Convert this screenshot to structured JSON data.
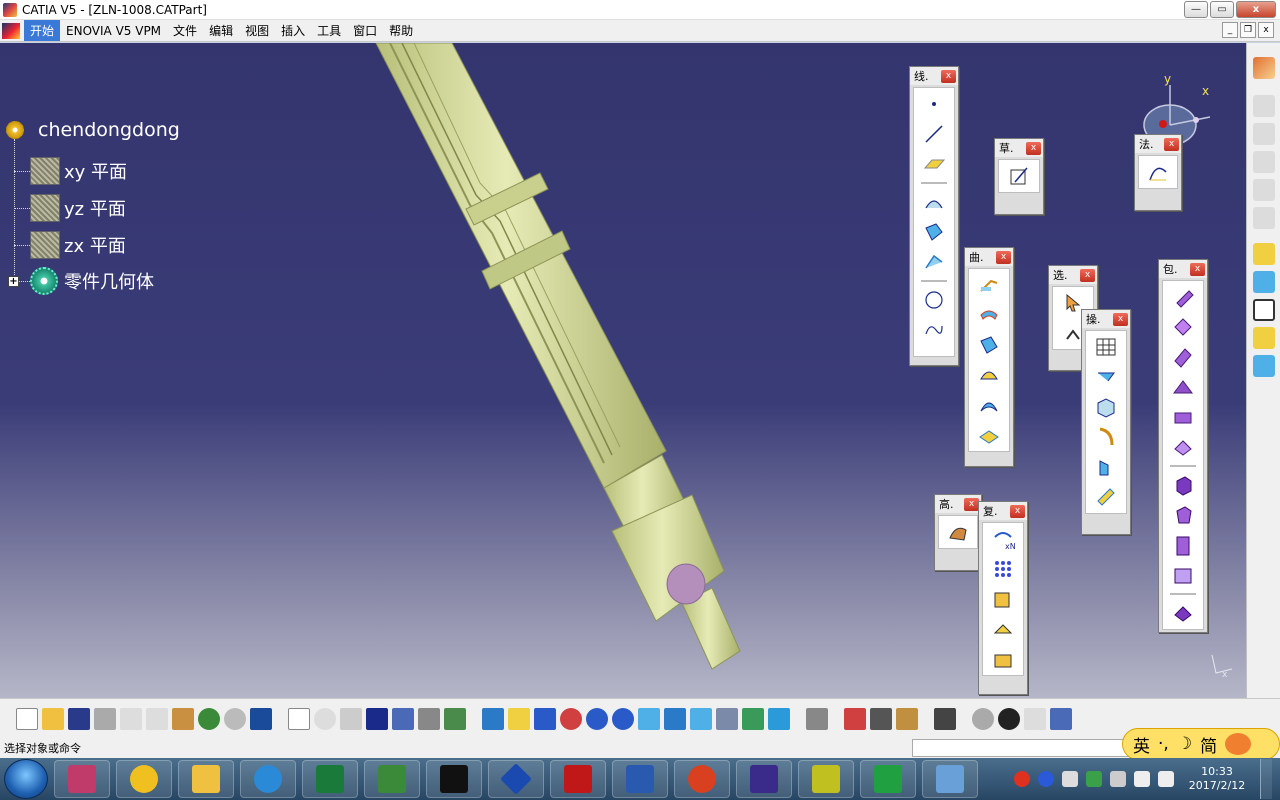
{
  "window": {
    "title": "CATIA V5 - [ZLN-1008.CATPart]",
    "min": "—",
    "max": "▭",
    "close": "x"
  },
  "menu": {
    "items": [
      "开始",
      "ENOVIA V5 VPM",
      "文件",
      "编辑",
      "视图",
      "插入",
      "工具",
      "窗口",
      "帮助"
    ],
    "active_index": 0
  },
  "tree": {
    "root": "chendongdong",
    "planes": [
      "xy 平面",
      "yz 平面",
      "zx 平面"
    ],
    "body": "零件几何体"
  },
  "compass": {
    "x_label": "x",
    "y_label": "y"
  },
  "floating_toolbars": {
    "wireframe": {
      "title": "线."
    },
    "sketcher": {
      "title": "草."
    },
    "law": {
      "title": "法."
    },
    "surfaces": {
      "title": "曲."
    },
    "select": {
      "title": "选."
    },
    "operations": {
      "title": "操."
    },
    "volumes": {
      "title": "包."
    },
    "advanced": {
      "title": "高."
    },
    "replication": {
      "title": "复."
    },
    "close_glyph": "x"
  },
  "statusbar": {
    "text": "选择对象或命令"
  },
  "ime": {
    "mode": "英",
    "extra": "·,",
    "moon": "☽",
    "script": "简"
  },
  "taskbar": {
    "time": "10:33",
    "date": "2017/2/12"
  },
  "colors": {
    "part": "#d6dca0",
    "part_shadow": "#a9b070",
    "pin": "#b48fbc",
    "viewport_top": "#34356e",
    "viewport_bottom": "#b5b7c8"
  }
}
